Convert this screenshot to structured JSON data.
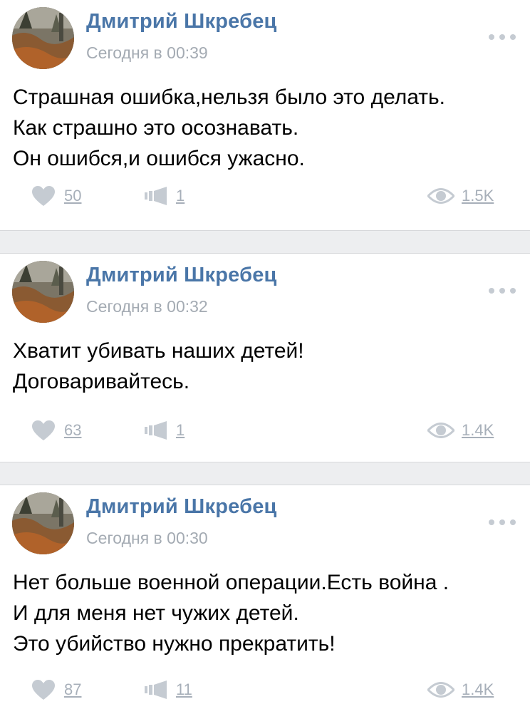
{
  "posts": [
    {
      "author": "Дмитрий Шкребец",
      "timestamp": "Сегодня в 00:39",
      "lines": [
        "Страшная ошибка,нельзя было это делать.",
        "Как страшно это осознавать.",
        "Он ошибся,и ошибся ужасно."
      ],
      "likes": "50",
      "reposts": "1",
      "views": "1.5K"
    },
    {
      "author": "Дмитрий Шкребец",
      "timestamp": "Сегодня в 00:32",
      "lines": [
        "Хватит убивать наших детей!",
        "Договаривайтесь."
      ],
      "likes": "63",
      "reposts": "1",
      "views": "1.4K"
    },
    {
      "author": "Дмитрий Шкребец",
      "timestamp": "Сегодня в 00:30",
      "lines": [
        "Нет больше военной операции.Есть война .",
        "И для меня нет чужих детей.",
        "Это убийство нужно прекратить!"
      ],
      "likes": "87",
      "reposts": "11",
      "views": "1.4K"
    }
  ],
  "colors": {
    "author": "#4a76a8",
    "meta": "#a4abb3",
    "icon": "#c5cbd2",
    "separator": "#edeef0"
  },
  "icons": {
    "like": "heart-icon",
    "share": "megaphone-icon",
    "views": "eye-icon",
    "more": "more-dots-icon"
  }
}
